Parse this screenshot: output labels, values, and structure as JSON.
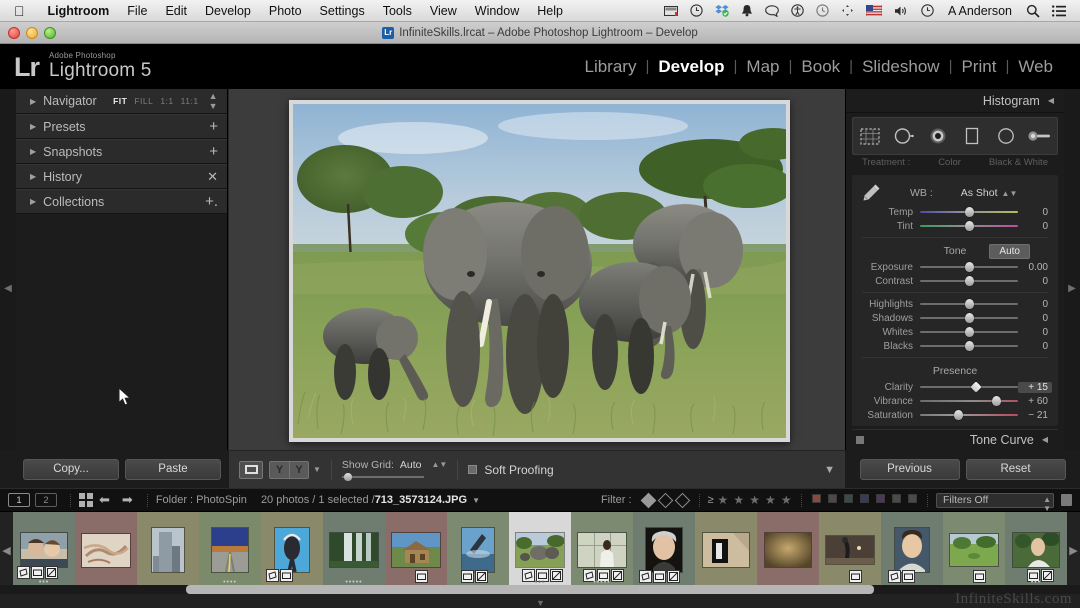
{
  "macbar": {
    "apple_icon": "apple-logo",
    "items": [
      {
        "label": "Lightroom",
        "bold": true
      },
      {
        "label": "File",
        "bold": false
      },
      {
        "label": "Edit",
        "bold": false
      },
      {
        "label": "Develop",
        "bold": false
      },
      {
        "label": "Photo",
        "bold": false
      },
      {
        "label": "Settings",
        "bold": false
      },
      {
        "label": "Tools",
        "bold": false
      },
      {
        "label": "View",
        "bold": false
      },
      {
        "label": "Window",
        "bold": false
      },
      {
        "label": "Help",
        "bold": false
      }
    ],
    "status_icons": [
      "screen-recorder-icon",
      "timemachine-icon",
      "dropbox-icon",
      "bell-icon",
      "chat-bubble-icon",
      "accessibility-icon",
      "clock-history-icon",
      "displays-icon",
      "flag-us-icon",
      "volume-icon",
      "time-machine-clock-icon"
    ],
    "user": "A Anderson",
    "search_icon": "search-icon",
    "menu_icon": "notification-center-icon"
  },
  "titlebar": {
    "doc_icon_text": "Lr",
    "title": "InfiniteSkills.lrcat – Adobe Photoshop Lightroom – Develop",
    "close": "close-button",
    "minimize": "minimize-button",
    "zoom": "zoom-button"
  },
  "header": {
    "logo_mark": "Lr",
    "product_sub": "Adobe Photoshop",
    "product_name": "Lightroom 5",
    "modules": [
      {
        "label": "Library",
        "active": false
      },
      {
        "label": "Develop",
        "active": true
      },
      {
        "label": "Map",
        "active": false
      },
      {
        "label": "Book",
        "active": false
      },
      {
        "label": "Slideshow",
        "active": false
      },
      {
        "label": "Print",
        "active": false
      },
      {
        "label": "Web",
        "active": false
      }
    ],
    "separator": "|"
  },
  "left_panel": {
    "panels": [
      {
        "label": "Navigator",
        "control": "zoom-modes"
      },
      {
        "label": "Presets",
        "control": "plus"
      },
      {
        "label": "Snapshots",
        "control": "plus"
      },
      {
        "label": "History",
        "control": "x"
      },
      {
        "label": "Collections",
        "control": "plus-dot"
      }
    ],
    "nav_modes": [
      {
        "label": "FIT",
        "active": true
      },
      {
        "label": "FILL",
        "active": false
      },
      {
        "label": "1:1",
        "active": false
      },
      {
        "label": "11:1",
        "active": false
      }
    ],
    "copy_label": "Copy...",
    "paste_label": "Paste"
  },
  "right_panel": {
    "histogram_title": "Histogram",
    "tools": [
      "crop-overlay-icon",
      "spot-removal-icon",
      "red-eye-correction-icon",
      "graduated-filter-icon",
      "radial-filter-icon",
      "adjustment-brush-icon"
    ],
    "treatment_row": [
      "Treatment :",
      "Color",
      "Black & White"
    ],
    "wb": {
      "eyedropper": "white-balance-selector-icon",
      "label": "WB :",
      "value": "As Shot"
    },
    "wb_sliders": [
      {
        "name": "Temp",
        "value": "0",
        "pos": 50,
        "track": "temp"
      },
      {
        "name": "Tint",
        "value": "0",
        "pos": 50,
        "track": "tint"
      }
    ],
    "tone": {
      "title": "Tone",
      "auto_label": "Auto",
      "sliders": [
        {
          "name": "Exposure",
          "value": "0.00",
          "pos": 50,
          "track": ""
        },
        {
          "name": "Contrast",
          "value": "0",
          "pos": 50,
          "track": ""
        }
      ],
      "sliders2": [
        {
          "name": "Highlights",
          "value": "0",
          "pos": 50,
          "track": ""
        },
        {
          "name": "Shadows",
          "value": "0",
          "pos": 50,
          "track": ""
        },
        {
          "name": "Whites",
          "value": "0",
          "pos": 50,
          "track": ""
        },
        {
          "name": "Blacks",
          "value": "0",
          "pos": 50,
          "track": ""
        }
      ]
    },
    "presence": {
      "title": "Presence",
      "sliders": [
        {
          "name": "Clarity",
          "value": "+ 15",
          "pos": 58,
          "track": "",
          "highlighted": true,
          "diamond": true
        },
        {
          "name": "Vibrance",
          "value": "+ 60",
          "pos": 78,
          "track": "vib",
          "highlighted": false,
          "diamond": false
        },
        {
          "name": "Saturation",
          "value": "− 21",
          "pos": 39,
          "track": "sat",
          "highlighted": false,
          "diamond": false
        }
      ]
    },
    "tone_curve_title": "Tone Curve",
    "previous_label": "Previous",
    "reset_label": "Reset"
  },
  "toolbar": {
    "loupe_icon": "loupe-view-icon",
    "before_after_label": "Y|Y",
    "show_grid_label": "Show Grid:",
    "show_grid_value": "Auto",
    "soft_proofing_label": "Soft Proofing",
    "soft_proofing_checked": false,
    "toolbar_caret": "chevron-down-icon"
  },
  "filmstrip_bar": {
    "screen_1": "1",
    "screen_2": "2",
    "grid_icon": "grid-view-icon",
    "back_icon": "navigate-back-icon",
    "forward_icon": "navigate-forward-icon",
    "folder_label": "Folder : PhotoSpin",
    "photo_count": "20 photos / 1 selected / ",
    "selected_file": "713_3573124.JPG",
    "file_caret": "chevron-down-icon",
    "filter_label": "Filter :",
    "rating_operator": "≥",
    "star_count": 5,
    "color_labels": [
      "#8a4a3a",
      "#4a4a4a",
      "#3a4a4a",
      "#3a3a5a",
      "#4a3a5a",
      "#4a4a4a",
      "#4a4a4a"
    ],
    "filters_value": "Filters Off",
    "lock_icon": "lock-filter-icon"
  },
  "filmstrip": {
    "prev_arrow": "filmstrip-scroll-left",
    "next_arrow": "filmstrip-scroll-right",
    "thumbnails": [
      {
        "id": 1,
        "bg": "#6f7d70",
        "rating": "•••",
        "badges": [
          "crop",
          "collection",
          "develop"
        ],
        "selected": false,
        "scene": "couple"
      },
      {
        "id": 2,
        "bg": "#8a6d68",
        "rating": "",
        "badges": [],
        "selected": false,
        "scene": "aerial"
      },
      {
        "id": 3,
        "bg": "#8a8a6a",
        "rating": "",
        "badges": [],
        "selected": false,
        "scene": "tower"
      },
      {
        "id": 4,
        "bg": "#7a8a6a",
        "rating": "••••",
        "badges": [],
        "selected": false,
        "scene": "road"
      },
      {
        "id": 5,
        "bg": "#8a8a6a",
        "rating": "",
        "badges": [
          "crop",
          "collection"
        ],
        "selected": false,
        "scene": "diver"
      },
      {
        "id": 6,
        "bg": "#6f7d70",
        "rating": "•••••",
        "badges": [],
        "selected": false,
        "scene": "waterfall"
      },
      {
        "id": 7,
        "bg": "#8a6d68",
        "rating": "",
        "badges": [
          "collection"
        ],
        "selected": false,
        "scene": "house"
      },
      {
        "id": 8,
        "bg": "#7d8a72",
        "rating": "",
        "badges": [
          "collection",
          "develop"
        ],
        "selected": false,
        "scene": "kayak"
      },
      {
        "id": 9,
        "bg": "#d8d8d8",
        "rating": "•••",
        "badges": [
          "crop",
          "collection",
          "develop"
        ],
        "selected": true,
        "scene": "elephants"
      },
      {
        "id": 10,
        "bg": "#7d8a72",
        "rating": "•••••",
        "badges": [
          "crop",
          "collection",
          "develop"
        ],
        "selected": false,
        "scene": "woman"
      },
      {
        "id": 11,
        "bg": "#6f7d70",
        "rating": "",
        "badges": [
          "crop",
          "collection",
          "develop"
        ],
        "selected": false,
        "scene": "portrait-elder"
      },
      {
        "id": 12,
        "bg": "#8a8a6a",
        "rating": "",
        "badges": [],
        "selected": false,
        "scene": "doorway"
      },
      {
        "id": 13,
        "bg": "#8a6d68",
        "rating": "",
        "badges": [],
        "selected": false,
        "scene": "wall"
      },
      {
        "id": 14,
        "bg": "#8a8a6a",
        "rating": "",
        "badges": [
          "collection"
        ],
        "selected": false,
        "scene": "dancer"
      },
      {
        "id": 15,
        "bg": "#6f7d70",
        "rating": "",
        "badges": [
          "crop",
          "collection"
        ],
        "selected": false,
        "scene": "man-portrait"
      },
      {
        "id": 16,
        "bg": "#7d8a72",
        "rating": "",
        "badges": [
          "collection"
        ],
        "selected": false,
        "scene": "field"
      },
      {
        "id": 17,
        "bg": "#6f7d70",
        "rating": "•••",
        "badges": [
          "collection",
          "develop"
        ],
        "selected": false,
        "scene": "man-sky"
      }
    ],
    "watermark": "InfiniteSkills.com"
  },
  "main_image": {
    "alt": "Three African elephants standing in tall green savanna grass with acacia trees and blue sky",
    "filename": "713_3573124.JPG"
  },
  "colors": {
    "panel_bg": "#1c1c1c",
    "canvas_bg": "#3c3c3c",
    "accent_text": "#ffffff",
    "muted_text": "#9c9c9c"
  }
}
